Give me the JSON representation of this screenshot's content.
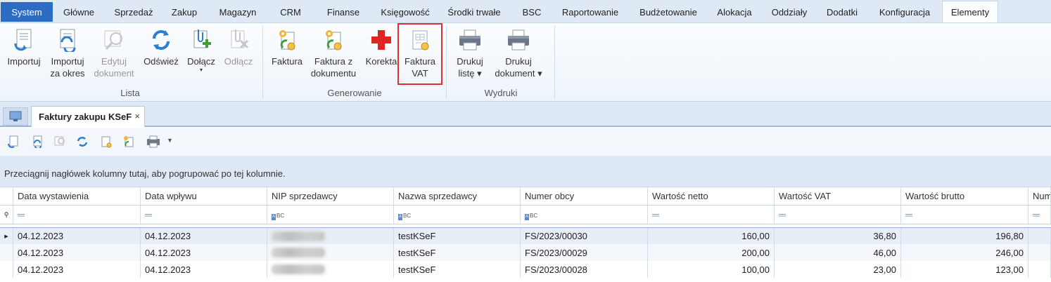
{
  "menu": {
    "tabs": [
      "System",
      "Główne",
      "Sprzedaż",
      "Zakup",
      "Magazyn",
      "CRM",
      "Finanse",
      "Księgowość",
      "Środki trwałe",
      "BSC",
      "Raportowanie",
      "Budżetowanie",
      "Alokacja",
      "Oddziały",
      "Dodatki",
      "Konfiguracja",
      "Elementy"
    ],
    "active": "Elementy"
  },
  "ribbon": {
    "lista": {
      "group_label": "Lista",
      "importuj": "Importuj",
      "importuj_okres": "Importuj\nza okres",
      "edytuj": "Edytuj\ndokument",
      "odswiez": "Odśwież",
      "dolacz": "Dołącz",
      "odlacz": "Odłącz"
    },
    "generowanie": {
      "group_label": "Generowanie",
      "faktura": "Faktura",
      "faktura_z_dok": "Faktura z\ndokumentu",
      "korekta": "Korekta",
      "faktura_vat": "Faktura\nVAT"
    },
    "wydruki": {
      "group_label": "Wydruki",
      "drukuj_liste": "Drukuj\nlistę ▾",
      "drukuj_dok": "Drukuj\ndokument ▾"
    }
  },
  "doc_tab": {
    "title": "Faktury zakupu KSeF",
    "close": "×"
  },
  "group_panel": "Przeciągnij nagłówek kolumny tutaj, aby pogrupować po tej kolumnie.",
  "grid": {
    "columns": [
      "Data wystawienia",
      "Data wpływu",
      "NIP sprzedawcy",
      "Nazwa sprzedawcy",
      "Numer obcy",
      "Wartość netto",
      "Wartość VAT",
      "Wartość brutto",
      "Num"
    ],
    "rows": [
      {
        "data_wyst": "04.12.2023",
        "data_wpl": "04.12.2023",
        "nazwa": "testKSeF",
        "numer": "FS/2023/00030",
        "netto": "160,00",
        "vat": "36,80",
        "brutto": "196,80"
      },
      {
        "data_wyst": "04.12.2023",
        "data_wpl": "04.12.2023",
        "nazwa": "testKSeF",
        "numer": "FS/2023/00029",
        "netto": "200,00",
        "vat": "46,00",
        "brutto": "246,00"
      },
      {
        "data_wyst": "04.12.2023",
        "data_wpl": "04.12.2023",
        "nazwa": "testKSeF",
        "numer": "FS/2023/00028",
        "netto": "100,00",
        "vat": "23,00",
        "brutto": "123,00"
      }
    ]
  },
  "colors": {
    "accent": "#2b6cc4",
    "highlight": "#e03030",
    "ribbon_bg": "#dfe9f5"
  }
}
